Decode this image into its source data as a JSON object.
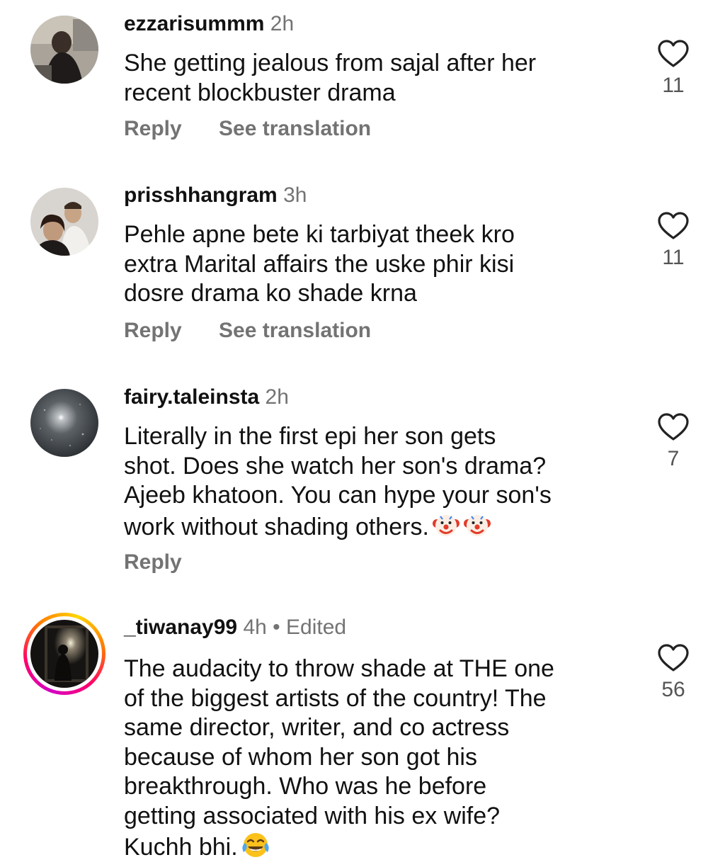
{
  "comments": [
    {
      "username": "ezzarisummm",
      "time": "2h",
      "edited": "",
      "lines": [
        "She getting jealous from sajal after her",
        "recent blockbuster drama"
      ],
      "reply": "Reply",
      "see_translation": "See translation",
      "likes": "11",
      "emojis": []
    },
    {
      "username": "prisshhangram",
      "time": "3h",
      "edited": "",
      "lines": [
        "Pehle apne bete ki tarbiyat theek kro",
        "extra Marital affairs the uske phir kisi",
        "dosre drama ko shade krna"
      ],
      "reply": "Reply",
      "see_translation": "See translation",
      "likes": "11",
      "emojis": []
    },
    {
      "username": "fairy.taleinsta",
      "time": "2h",
      "edited": "",
      "lines": [
        "Literally in the first epi her son gets",
        "shot. Does she watch her son's drama?",
        "Ajeeb khatoon. You can hype your son's",
        "work without shading others."
      ],
      "reply": "Reply",
      "see_translation": "",
      "likes": "7",
      "emojis": [
        "clown-face-emoji",
        "clown-face-emoji"
      ]
    },
    {
      "username": "_tiwanay99",
      "time": "4h",
      "edited": "Edited",
      "separator": "•",
      "lines": [
        "The audacity to throw shade at THE one",
        "of the biggest artists of the country! The",
        "same director, writer, and co actress",
        "because of whom her son got his",
        "breakthrough. Who was he before",
        "getting associated with his ex wife?",
        "Kuchh bhi."
      ],
      "reply": "",
      "see_translation": "",
      "likes": "56",
      "emojis": [
        "face-with-tears-of-joy-emoji"
      ]
    }
  ],
  "colors": {
    "text": "#111111",
    "secondary": "#737373",
    "heart_stroke": "#222222"
  },
  "icons": {
    "like": "heart-outline-icon"
  }
}
